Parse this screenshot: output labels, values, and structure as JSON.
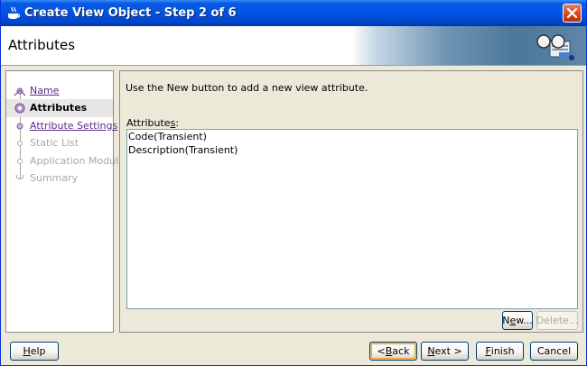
{
  "window": {
    "title": "Create View Object - Step 2 of 6",
    "close_icon": "close-icon",
    "app_icon": "coffee-cup-icon"
  },
  "header": {
    "title": "Attributes",
    "icon": "view-object-glasses-icon"
  },
  "steps": [
    {
      "label": "Name",
      "state": "link"
    },
    {
      "label": "Attributes",
      "state": "current"
    },
    {
      "label": "Attribute Settings",
      "state": "link"
    },
    {
      "label": "Static List",
      "state": "disabled"
    },
    {
      "label": "Application Module",
      "state": "disabled"
    },
    {
      "label": "Summary",
      "state": "disabled"
    }
  ],
  "content": {
    "instruction": "Use the New button to add a new view attribute.",
    "list_label_pre": "Attribute",
    "list_label_mnemonic": "s",
    "list_label_post": ":",
    "attributes": [
      "Code(Transient)",
      "Description(Transient)"
    ],
    "new_button": {
      "pre": "N",
      "mnemonic": "e",
      "post": "w..."
    },
    "delete_button": {
      "label": "Delete...",
      "enabled": false
    }
  },
  "footer": {
    "help": {
      "pre": "",
      "mnemonic": "H",
      "post": "elp"
    },
    "back": {
      "pre": "< ",
      "mnemonic": "B",
      "post": "ack"
    },
    "next": {
      "pre": "",
      "mnemonic": "N",
      "post": "ext >"
    },
    "finish": {
      "pre": "",
      "mnemonic": "F",
      "post": "inish"
    },
    "cancel": {
      "label": "Cancel"
    }
  }
}
